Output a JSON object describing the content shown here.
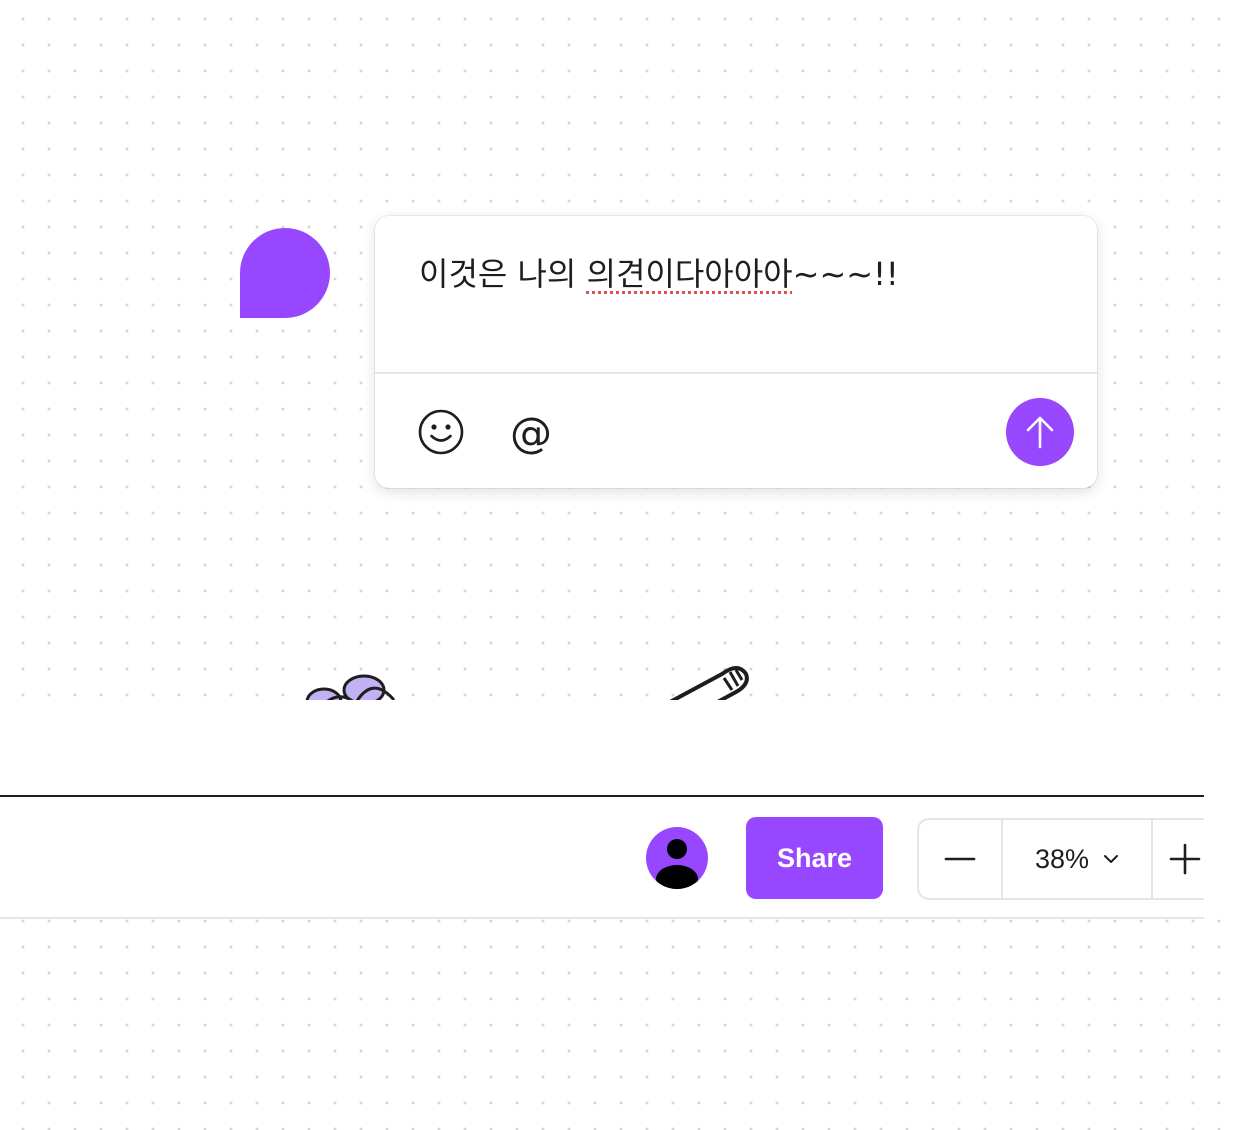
{
  "comment": {
    "text_before": "이것은 나의 ",
    "text_misspelled": "의견이다아아아",
    "text_after": "~~~!!",
    "accent_color": "#9747ff"
  },
  "comment_actions": {
    "emoji_icon": "smiley-icon",
    "mention_symbol": "@",
    "send_icon": "arrow-up-icon"
  },
  "toolbar": {
    "share_label": "Share",
    "zoom_out_icon": "minus-icon",
    "zoom_level": "38%",
    "zoom_dropdown_icon": "chevron-down-icon",
    "zoom_in_icon": "plus-icon",
    "avatar_icon": "user-icon"
  },
  "colors": {
    "accent": "#9747ff",
    "text": "#1e1e1e",
    "spellcheck": "#e0524d"
  }
}
